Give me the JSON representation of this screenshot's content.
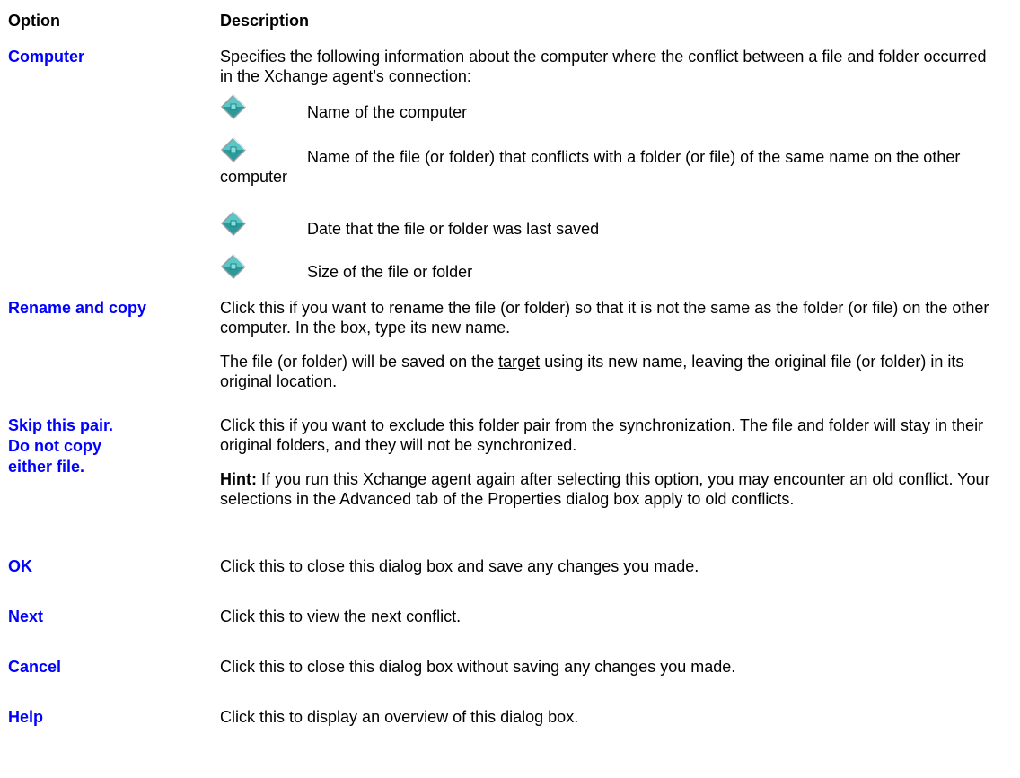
{
  "header": {
    "option": "Option",
    "description": "Description"
  },
  "rows": [
    {
      "option": "Computer",
      "description": "Specifies the following information about the computer where the conflict between a file and folder occurred in the Xchange agent’s connection:",
      "bullets": [
        "Name of the computer",
        "Name of the file (or folder) that conflicts with a folder (or file) of the same name on the other computer",
        "Date that the file or folder was last saved",
        "Size of the file or folder"
      ]
    },
    {
      "option": "Rename and copy",
      "description": "Click this if you want to rename the file (or folder) so that it is not the same as the folder (or file) on the other computer. In the box, type its new name.",
      "note_prefix": "The file (or folder) will be saved on the ",
      "note_link": "target",
      "note_suffix": " using its new name, leaving the original file (or folder) in its original location."
    },
    {
      "option": "Skip this pair. Do not copy either file.",
      "description": "Click this if you want to exclude this folder pair from the synchronization. The file and folder will stay in their original folders, and they will not be synchronized.",
      "hint_label": "Hint:",
      "hint_text": " If you run this Xchange agent again after selecting this option, you may encounter an old conflict. Your selections in the Advanced tab of the Properties dialog box apply to old conflicts."
    },
    {
      "option": "OK",
      "description": "Click this to close this dialog box and save any changes you made."
    },
    {
      "option": "Next",
      "description": "Click this to view the next conflict."
    },
    {
      "option": "Cancel",
      "description": "Click this to close this dialog box without saving any changes you made."
    },
    {
      "option": "Help",
      "description": "Click this to display an overview of this dialog box."
    }
  ],
  "icons": {
    "bullet": "diamond-bullet-icon"
  },
  "colors": {
    "option_link": "#0000ff",
    "bullet_teal": "#2a9a9a"
  }
}
